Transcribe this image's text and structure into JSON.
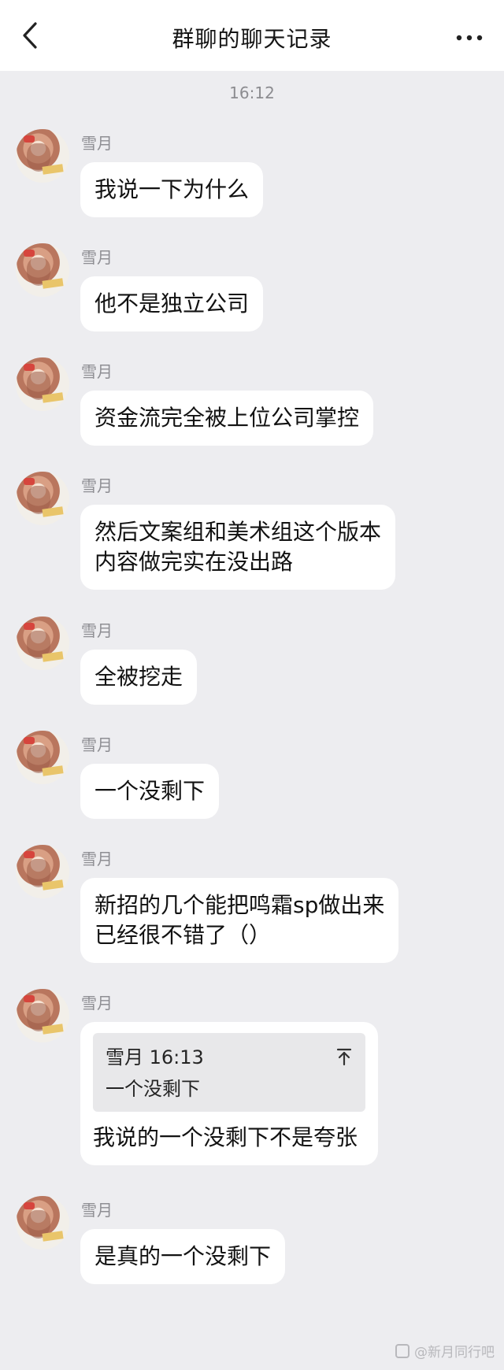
{
  "header": {
    "title": "群聊的聊天记录"
  },
  "timestamp": "16:12",
  "messages": [
    {
      "sender": "雪月",
      "lines": [
        "我说一下为什么"
      ]
    },
    {
      "sender": "雪月",
      "lines": [
        "他不是独立公司"
      ]
    },
    {
      "sender": "雪月",
      "lines": [
        "资金流完全被上位公司掌控"
      ]
    },
    {
      "sender": "雪月",
      "lines": [
        "然后文案组和美术组这个版本",
        "内容做完实在没出路"
      ]
    },
    {
      "sender": "雪月",
      "lines": [
        "全被挖走"
      ]
    },
    {
      "sender": "雪月",
      "lines": [
        "一个没剩下"
      ]
    },
    {
      "sender": "雪月",
      "lines": [
        "新招的几个能把鸣霜sp做出来",
        "已经很不错了（）"
      ]
    },
    {
      "sender": "雪月",
      "quote": {
        "header": "雪月 16:13",
        "text": "一个没剩下"
      },
      "lines": [
        "我说的一个没剩下不是夸张"
      ]
    },
    {
      "sender": "雪月",
      "lines": [
        "是真的一个没剩下"
      ]
    }
  ],
  "watermark": "@新月同行吧"
}
